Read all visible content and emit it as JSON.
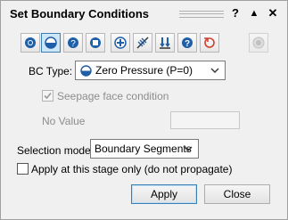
{
  "window": {
    "title": "Set Boundary Conditions",
    "help_glyph": "?",
    "collapse_glyph": "▲",
    "close_glyph": "✕"
  },
  "toolbar": {
    "buttons": [
      {
        "icon": "fixed-head-icon"
      },
      {
        "icon": "zero-pressure-icon",
        "active": true
      },
      {
        "icon": "unknown-icon"
      },
      {
        "icon": "infiltration-icon"
      },
      {
        "icon": "add-flux-icon"
      },
      {
        "icon": "seepage-icon"
      },
      {
        "icon": "drain-icon"
      },
      {
        "icon": "help-icon"
      },
      {
        "icon": "reset-icon"
      },
      {
        "icon": "disabled-radio-icon"
      }
    ]
  },
  "bc_type": {
    "label": "BC Type:",
    "value": "Zero Pressure (P=0)"
  },
  "seepage": {
    "label": "Seepage face condition",
    "checked": true,
    "enabled": false
  },
  "no_value": {
    "label": "No Value",
    "value": ""
  },
  "selection": {
    "label": "Selection mode:",
    "value": "Boundary Segments"
  },
  "apply_stage": {
    "label": "Apply at this stage only (do not propagate)",
    "checked": false
  },
  "buttons": {
    "apply": "Apply",
    "close": "Close"
  }
}
